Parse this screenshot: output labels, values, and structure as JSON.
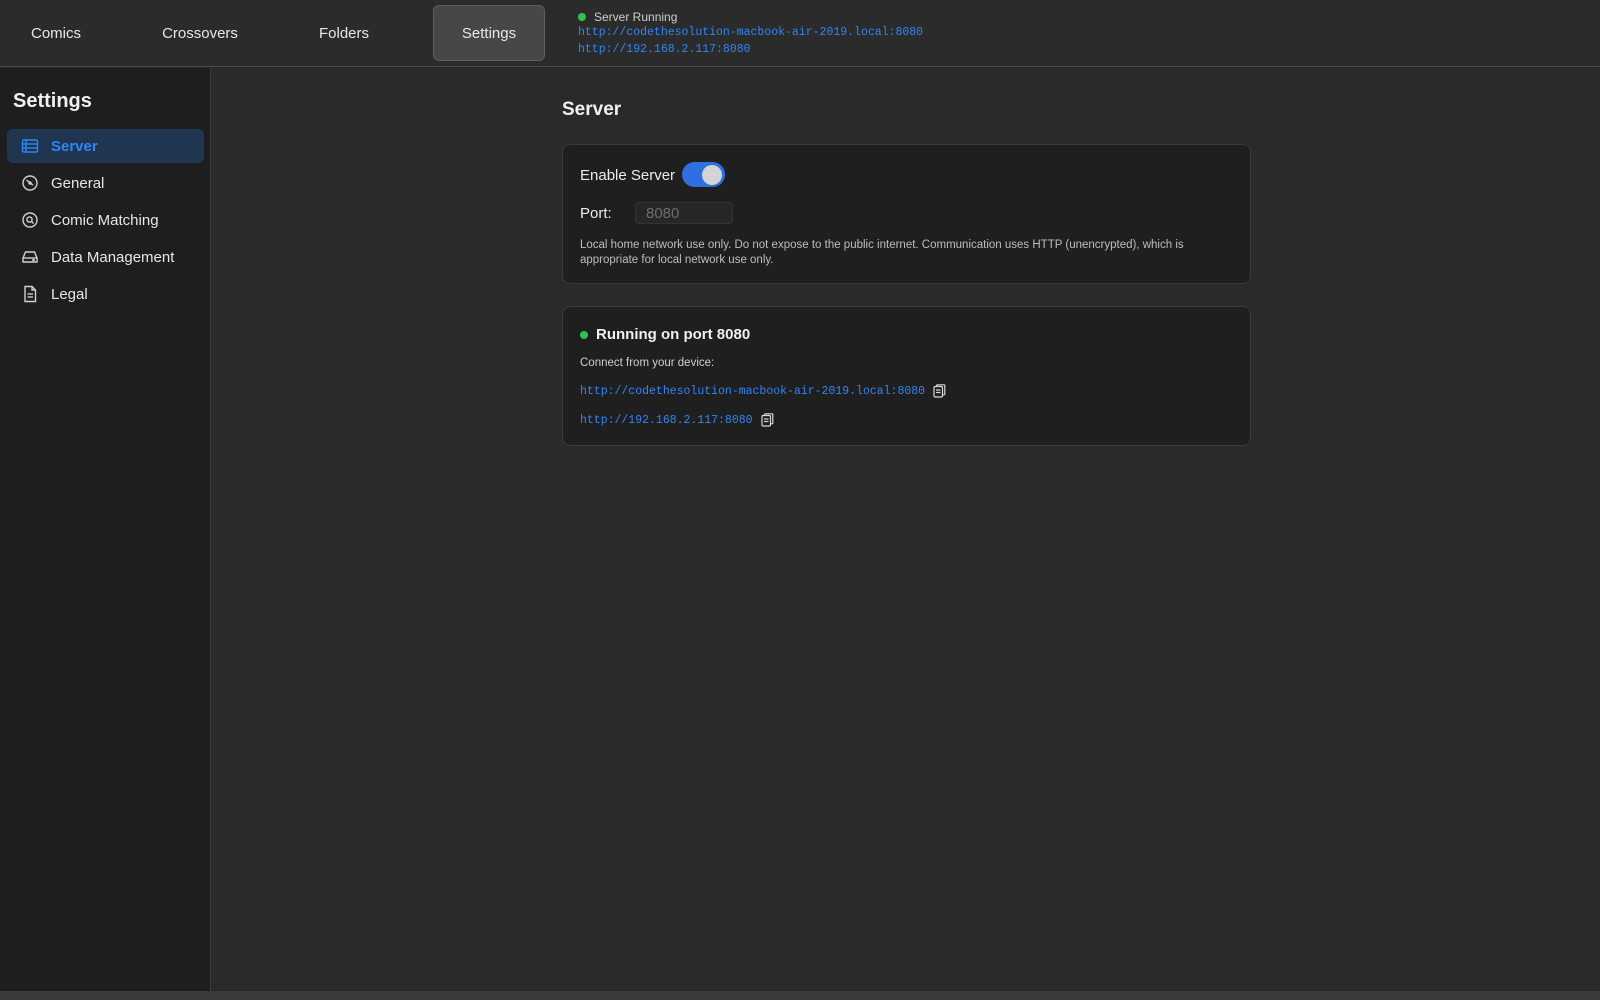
{
  "tabs": [
    {
      "label": "Comics"
    },
    {
      "label": "Crossovers"
    },
    {
      "label": "Folders"
    },
    {
      "label": "Settings"
    }
  ],
  "topbar_status": {
    "text": "Server Running",
    "links": [
      "http://codethesolution-macbook-air-2019.local:8080",
      "http://192.168.2.117:8080"
    ]
  },
  "sidebar": {
    "title": "Settings",
    "items": [
      {
        "label": "Server",
        "icon": "server-icon"
      },
      {
        "label": "General",
        "icon": "gauge-icon"
      },
      {
        "label": "Comic Matching",
        "icon": "magnify-icon"
      },
      {
        "label": "Data Management",
        "icon": "drive-icon"
      },
      {
        "label": "Legal",
        "icon": "document-icon"
      }
    ]
  },
  "main": {
    "title": "Server",
    "enable_label": "Enable Server",
    "enabled": true,
    "port_label": "Port:",
    "port_placeholder": "8080",
    "note": "Local home network use only. Do not expose to the public internet. Communication uses HTTP (unencrypted), which is appropriate for local network use only.",
    "running_text": "Running on port 8080",
    "connect_text": "Connect from your device:",
    "links": [
      "http://codethesolution-macbook-air-2019.local:8080",
      "http://192.168.2.117:8080"
    ]
  },
  "colors": {
    "accent": "#2f86f5",
    "status_green": "#31c24d",
    "toggle_on": "#2f6fe0"
  }
}
